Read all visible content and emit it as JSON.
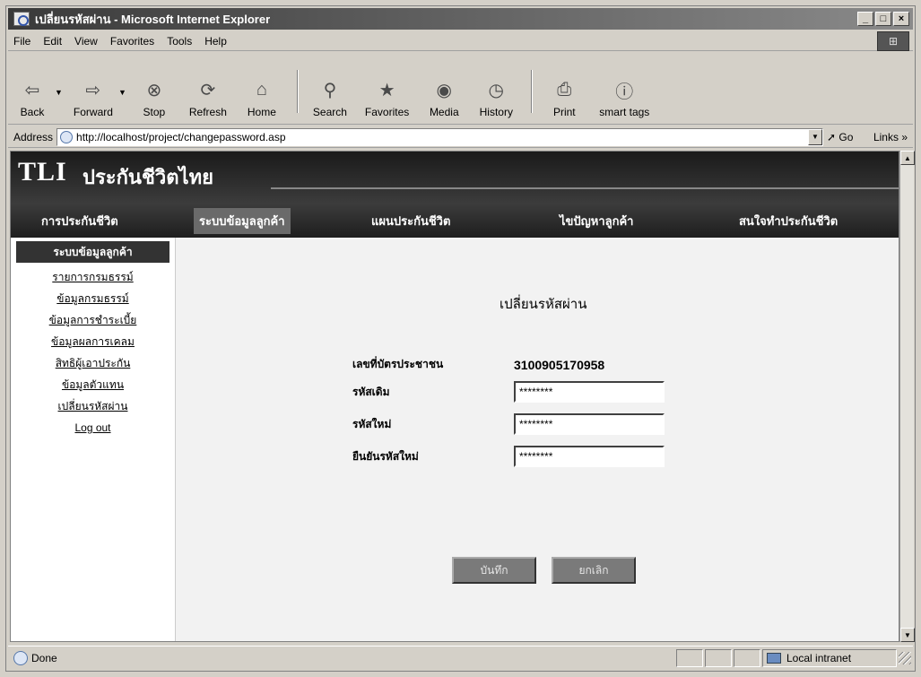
{
  "window": {
    "title": "เปลี่ยนรหัสผ่าน - Microsoft Internet Explorer",
    "controls": {
      "minimize": "_",
      "maximize": "□",
      "close": "×"
    }
  },
  "menu": [
    "File",
    "Edit",
    "View",
    "Favorites",
    "Tools",
    "Help"
  ],
  "toolbar": {
    "back": "Back",
    "forward": "Forward",
    "stop": "Stop",
    "refresh": "Refresh",
    "home": "Home",
    "search": "Search",
    "favorites": "Favorites",
    "media": "Media",
    "history": "History",
    "print": "Print",
    "smart_tags": "smart tags"
  },
  "address": {
    "label": "Address",
    "url": "http://localhost/project/changepassword.asp",
    "go": "Go",
    "links": "Links »"
  },
  "site": {
    "logo": "TLI",
    "name": "ประกันชีวิตไทย",
    "nav": [
      "การประกันชีวิต",
      "ระบบข้อมูลลูกค้า",
      "แผนประกันชีวิต",
      "ไขปัญหาลูกค้า",
      "สนใจทำประกันชีวิต"
    ]
  },
  "sidebar": {
    "heading": "ระบบข้อมูลลูกค้า",
    "links": [
      "รายการกรมธรรม์",
      "ข้อมูลกรมธรรม์",
      "ข้อมูลการชำระเบี้ย",
      "ข้อมูลผลการเคลม",
      "สิทธิผู้เอาประกัน",
      "ข้อมูลตัวแทน",
      "เปลี่ยนรหัสผ่าน",
      "Log out"
    ]
  },
  "form": {
    "title": "เปลี่ยนรหัสผ่าน",
    "id_label": "เลขที่บัตรประชาชน",
    "id_value": "3100905170958",
    "old_label": "รหัสเดิม",
    "old_value": "********",
    "new_label": "รหัสใหม่",
    "new_value": "********",
    "confirm_label": "ยืนยันรหัสใหม่",
    "confirm_value": "********",
    "save": "บันทึก",
    "cancel": "ยกเลิก"
  },
  "status": {
    "text": "Done",
    "zone": "Local intranet"
  }
}
